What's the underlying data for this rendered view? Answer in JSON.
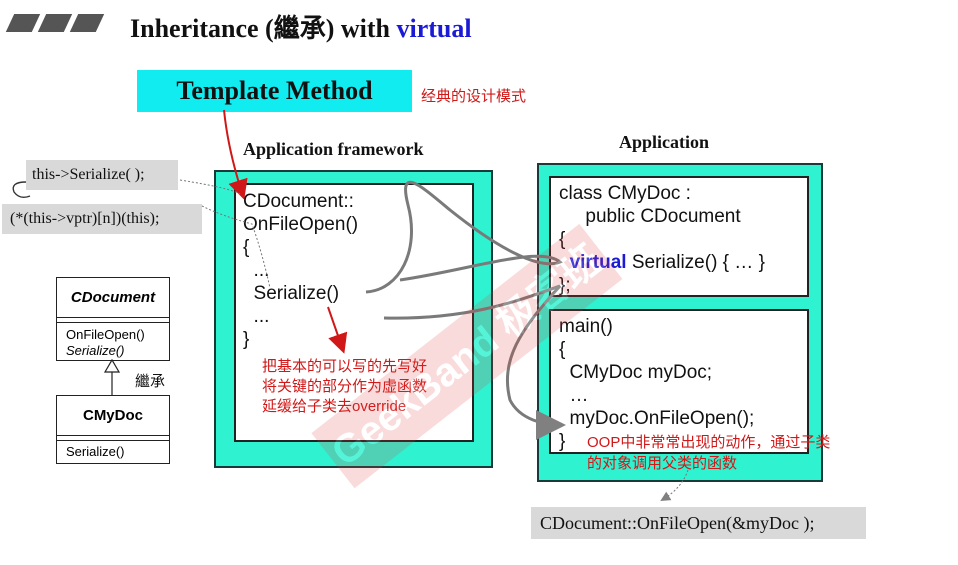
{
  "title": {
    "prefix": "Inheritance (繼承) with ",
    "keyword": "virtual"
  },
  "template_method": {
    "label": "Template Method",
    "note": "经典的设计模式"
  },
  "framework": {
    "header": "Application framework",
    "lines": [
      "CDocument::",
      "OnFileOpen()",
      "{",
      "  ...",
      "  Serialize()",
      "  ...",
      "}"
    ],
    "note_lines": [
      "把基本的可以写的先写好",
      "将关键的部分作为虚函数",
      "延缓给子类去override"
    ]
  },
  "application": {
    "header": "Application",
    "class_lines": [
      "class CMyDoc :",
      "     public CDocument",
      "{"
    ],
    "virtual_keyword": "virtual",
    "virtual_rest": " Serialize() { … }",
    "class_end": "};",
    "main_lines": [
      "main()",
      "{",
      "  CMyDoc myDoc;",
      "  …",
      "  myDoc.OnFileOpen();",
      "}"
    ],
    "oop_note_lines": [
      "OOP中非常常出现的动作，通过子类",
      "的对象调用父类的函数"
    ]
  },
  "left_notes": {
    "this_call": "this->Serialize( );",
    "vptr_call": "(*(this->vptr)[n])(this);"
  },
  "uml": {
    "parent_name": "CDocument",
    "parent_methods": [
      "OnFileOpen()",
      "Serialize()"
    ],
    "inherit_label": "繼承",
    "child_name": "CMyDoc",
    "child_methods": [
      "Serialize()"
    ]
  },
  "bottom_call": "CDocument::OnFileOpen(&myDoc );",
  "watermark": "GeekBand 极客班",
  "colors": {
    "teal": "#2ff2d0",
    "cyan_box": "#10ecf0",
    "red_note": "#d01818",
    "keyword_blue": "#1b1bd6",
    "gray_box": "#d9d9d9"
  }
}
